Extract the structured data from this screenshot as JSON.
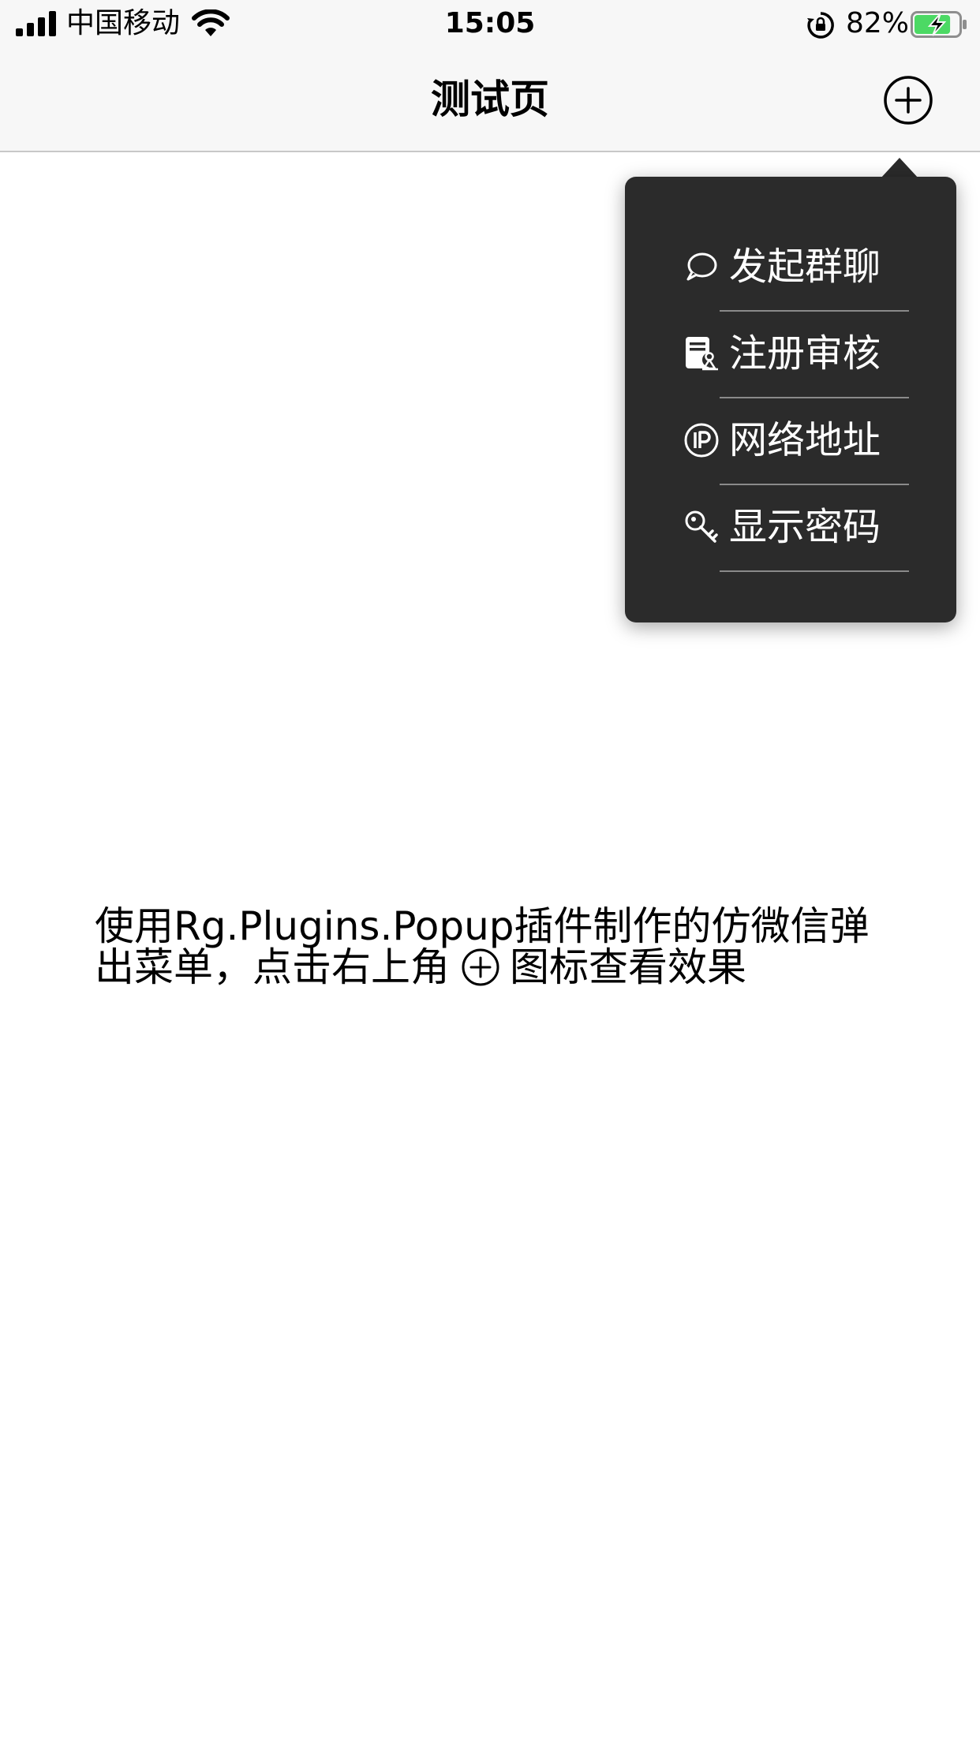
{
  "status_bar": {
    "carrier": "中国移动",
    "time": "15:05",
    "battery_percent": "82%",
    "battery_level": 0.82,
    "battery_charging": true,
    "signal_icon": "cellular-signal-icon",
    "wifi_icon": "wifi-icon",
    "rotation_lock_icon": "rotation-lock-icon"
  },
  "nav": {
    "title": "测试页",
    "add_icon": "plus-circle-icon"
  },
  "popup_menu": {
    "background": "#2b2b2b",
    "items": [
      {
        "label": "发起群聊",
        "icon": "chat-bubble-icon"
      },
      {
        "label": "注册审核",
        "icon": "document-review-icon"
      },
      {
        "label": "网络地址",
        "icon": "ip-address-icon"
      },
      {
        "label": "显示密码",
        "icon": "key-icon"
      }
    ]
  },
  "content": {
    "text_before": "使用Rg.Plugins.Popup插件制作的仿微信弹出菜单，点击右上角",
    "inline_icon": "plus-circle-icon",
    "text_after": "图标查看效果"
  }
}
